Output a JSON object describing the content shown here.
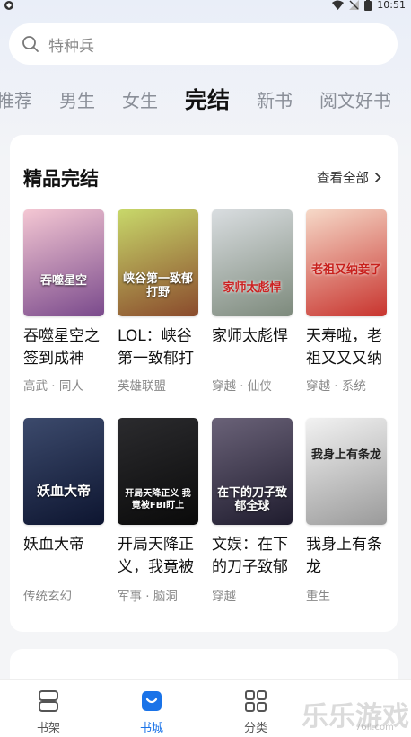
{
  "status_bar": {
    "time": "10:51"
  },
  "search": {
    "placeholder": "特种兵"
  },
  "tabs": [
    {
      "label": "推荐"
    },
    {
      "label": "男生"
    },
    {
      "label": "女生"
    },
    {
      "label": "完结",
      "active": true
    },
    {
      "label": "新书"
    },
    {
      "label": "阅文好书"
    }
  ],
  "section": {
    "title": "精品完结",
    "more_label": "查看全部"
  },
  "books": [
    {
      "title": "吞噬星空之签到成神",
      "tags": "高武 · 同人",
      "cover_text": "吞噬星空",
      "colors": [
        "#f4c7d3",
        "#7a4a8c"
      ]
    },
    {
      "title": "LOL：峡谷第一致郁打",
      "tags": "英雄联盟",
      "cover_text": "峡谷第一致郁打野",
      "colors": [
        "#c8d86a",
        "#8a4a2c"
      ]
    },
    {
      "title": "家师太彪悍",
      "tags": "穿越 · 仙侠",
      "cover_text": "家师太彪悍",
      "colors": [
        "#d9dde0",
        "#7d8a7c"
      ]
    },
    {
      "title": "天寿啦，老祖又又又纳",
      "tags": "穿越 · 系统",
      "cover_text": "老祖又纳妾了",
      "colors": [
        "#f6d9c8",
        "#c8342e"
      ]
    },
    {
      "title": "妖血大帝",
      "tags": "传统玄幻",
      "cover_text": "妖血大帝",
      "colors": [
        "#3c4a6c",
        "#0d1530"
      ]
    },
    {
      "title": "开局天降正义，我竟被",
      "tags": "军事 · 脑洞",
      "cover_text": "开局天降正义 我竟被FBI盯上",
      "colors": [
        "#2b2b2e",
        "#0a0a0a"
      ]
    },
    {
      "title": "文娱：在下的刀子致郁",
      "tags": "穿越",
      "cover_text": "在下的刀子致郁全球",
      "colors": [
        "#6a6278",
        "#1f1c2e"
      ]
    },
    {
      "title": "我身上有条龙",
      "tags": "重生",
      "cover_text": "我身上有条龙",
      "colors": [
        "#f2f2f2",
        "#9a9a9a"
      ]
    }
  ],
  "nav": [
    {
      "label": "书架"
    },
    {
      "label": "书城",
      "active": true
    },
    {
      "label": "分类"
    }
  ],
  "watermark": {
    "text": "乐乐游戏",
    "sub": "76ll.com"
  },
  "colors": {
    "accent": "#1a73e8"
  }
}
